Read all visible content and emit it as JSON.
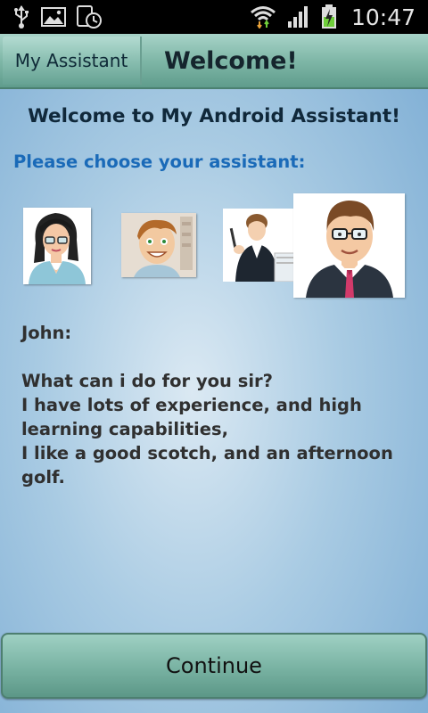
{
  "status_bar": {
    "time": "10:47",
    "icons": [
      "usb-icon",
      "image-icon",
      "clock-app-icon",
      "wifi-icon",
      "signal-icon",
      "battery-charging-icon"
    ]
  },
  "header": {
    "app_tab": "My Assistant",
    "title": "Welcome!"
  },
  "main": {
    "welcome": "Welcome to My Android Assistant!",
    "choose_prompt": "Please choose your assistant:",
    "selected_name": "John:",
    "description_lines": [
      "What can i do for you sir?",
      "I have lots of experience, and high learning capabilities,",
      "I like a good scotch, and an afternoon golf."
    ]
  },
  "footer": {
    "continue_label": "Continue"
  },
  "colors": {
    "actionbar": "#7fb7a7",
    "prompt": "#1a6ab8"
  }
}
